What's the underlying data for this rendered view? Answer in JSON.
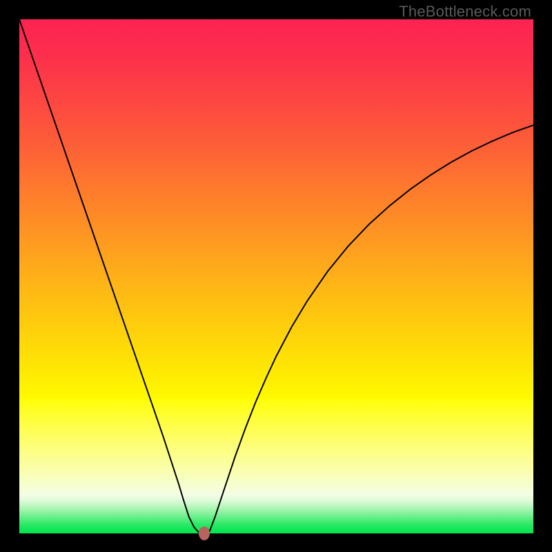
{
  "watermark": "TheBottleneck.com",
  "colors": {
    "marker": "#b9635e",
    "curve": "#000000",
    "frame": "#000000"
  },
  "gradient_stops": [
    {
      "offset": 0.0,
      "color": "#fd2252"
    },
    {
      "offset": 0.07,
      "color": "#fd2f4c"
    },
    {
      "offset": 0.15,
      "color": "#fd4443"
    },
    {
      "offset": 0.24,
      "color": "#fd5d38"
    },
    {
      "offset": 0.33,
      "color": "#fe7a2d"
    },
    {
      "offset": 0.42,
      "color": "#fe9622"
    },
    {
      "offset": 0.51,
      "color": "#feb317"
    },
    {
      "offset": 0.6,
      "color": "#fecf0c"
    },
    {
      "offset": 0.68,
      "color": "#fee703"
    },
    {
      "offset": 0.738,
      "color": "#fefa00"
    },
    {
      "offset": 0.739,
      "color": "#fffe08"
    },
    {
      "offset": 0.78,
      "color": "#fffe3e"
    },
    {
      "offset": 0.83,
      "color": "#fdfe78"
    },
    {
      "offset": 0.88,
      "color": "#f9feb0"
    },
    {
      "offset": 0.924,
      "color": "#f4fde4"
    },
    {
      "offset": 0.935,
      "color": "#e2fbdb"
    },
    {
      "offset": 0.945,
      "color": "#c2f8c4"
    },
    {
      "offset": 0.955,
      "color": "#9ef4ab"
    },
    {
      "offset": 0.965,
      "color": "#76f092"
    },
    {
      "offset": 0.975,
      "color": "#4cec79"
    },
    {
      "offset": 0.985,
      "color": "#24e862"
    },
    {
      "offset": 1.0,
      "color": "#00e54e"
    }
  ],
  "chart_data": {
    "type": "line",
    "title": "",
    "xlabel": "",
    "ylabel": "",
    "xlim": [
      0,
      100
    ],
    "ylim": [
      0,
      100
    ],
    "grid": false,
    "x": [
      0,
      2,
      4,
      6,
      8,
      10,
      12,
      14,
      16,
      18,
      20,
      22,
      24,
      26,
      28,
      29.5,
      31,
      32,
      33,
      34,
      34.8,
      35.5,
      36,
      37,
      38,
      40,
      42,
      44,
      46,
      48,
      50,
      53,
      56,
      60,
      64,
      68,
      72,
      76,
      80,
      84,
      88,
      92,
      96,
      100
    ],
    "y": [
      100,
      94.2,
      88.4,
      82.6,
      76.8,
      71.0,
      65.2,
      59.4,
      53.6,
      47.8,
      42.0,
      36.2,
      30.4,
      24.6,
      18.8,
      14.2,
      9.6,
      6.3,
      3.2,
      1.2,
      0.3,
      0.0,
      0.0,
      0.4,
      3.0,
      9.0,
      15.0,
      20.5,
      25.6,
      30.2,
      34.5,
      40.2,
      45.2,
      51.0,
      55.9,
      60.1,
      63.7,
      66.9,
      69.7,
      72.2,
      74.4,
      76.3,
      78.0,
      79.4
    ],
    "marker": {
      "x": 36.0,
      "y": 0.0
    }
  }
}
